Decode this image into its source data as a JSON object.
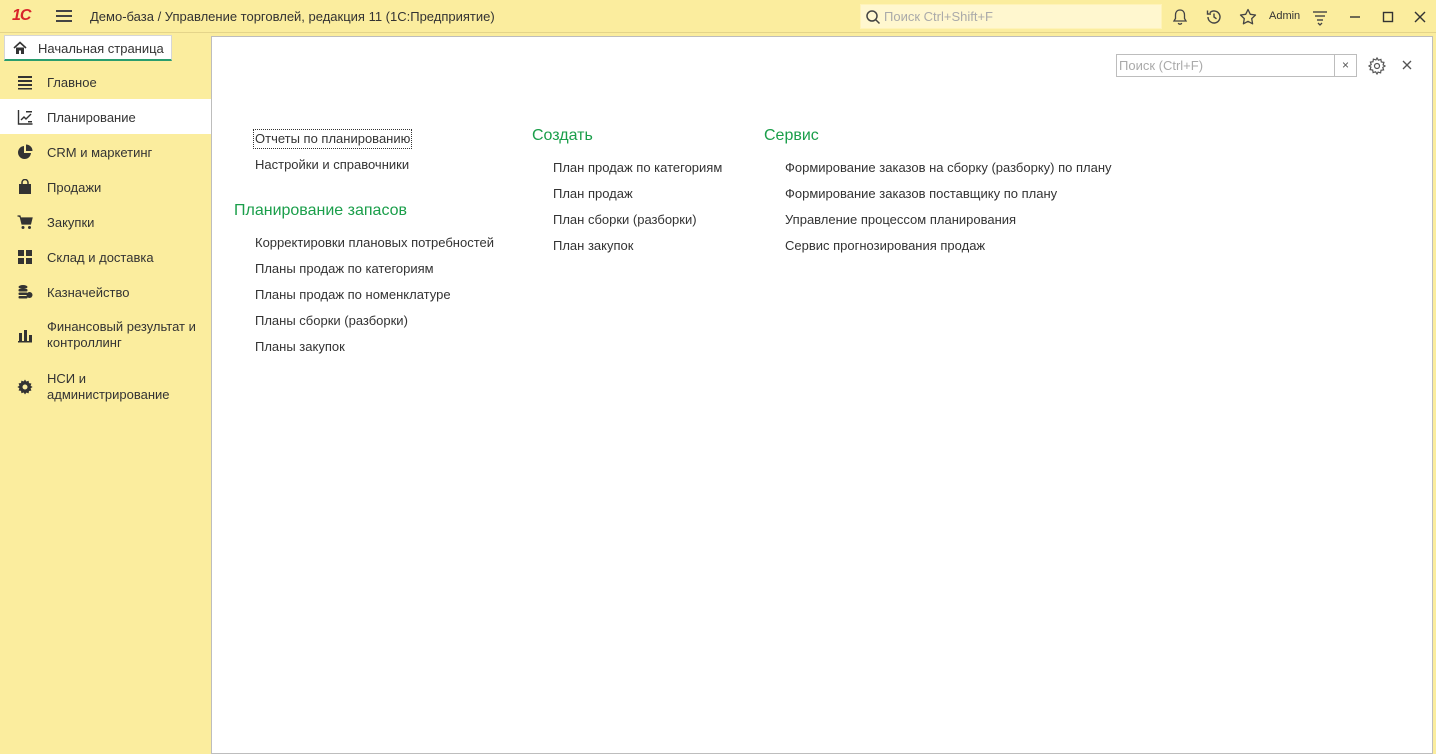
{
  "titlebar": {
    "logo": "1С",
    "title": "Демо-база / Управление торговлей, редакция 11  (1С:Предприятие)",
    "search_placeholder": "Поиск Ctrl+Shift+F",
    "user": "Admin"
  },
  "tabs": {
    "home_label": "Начальная страница"
  },
  "sidebar": {
    "items": [
      {
        "label": "Главное",
        "icon": "menu-lines-icon"
      },
      {
        "label": "Планирование",
        "icon": "planning-chart-icon"
      },
      {
        "label": "CRM и маркетинг",
        "icon": "pie-chart-icon"
      },
      {
        "label": "Продажи",
        "icon": "shopping-bag-icon"
      },
      {
        "label": "Закупки",
        "icon": "cart-icon"
      },
      {
        "label": "Склад и доставка",
        "icon": "warehouse-grid-icon"
      },
      {
        "label": "Казначейство",
        "icon": "coins-icon"
      },
      {
        "label": "Финансовый результат и контроллинг",
        "icon": "bar-chart-icon"
      },
      {
        "label": "НСИ и администрирование",
        "icon": "gear-icon"
      }
    ],
    "active_index": 1
  },
  "panel": {
    "search_placeholder": "Поиск (Ctrl+F)",
    "clear_label": "×",
    "close_label": "×",
    "col1": {
      "links": [
        "Отчеты по планированию",
        "Настройки и справочники"
      ],
      "group_title": "Планирование запасов",
      "group_links": [
        "Корректировки плановых потребностей",
        "Планы продаж по категориям",
        "Планы продаж по номенклатуре",
        "Планы сборки (разборки)",
        "Планы закупок"
      ]
    },
    "col2": {
      "group_title": "Создать",
      "links": [
        "План продаж по категориям",
        "План продаж",
        "План сборки (разборки)",
        "План закупок"
      ]
    },
    "col3": {
      "group_title": "Сервис",
      "links": [
        "Формирование заказов на сборку (разборку) по плану",
        "Формирование заказов поставщику по плану",
        "Управление процессом планирования",
        "Сервис прогнозирования продаж"
      ]
    }
  },
  "colors": {
    "accent_green": "#1a9e4a",
    "sidebar_bg": "#fbed9e",
    "logo_red": "#d8232a"
  }
}
